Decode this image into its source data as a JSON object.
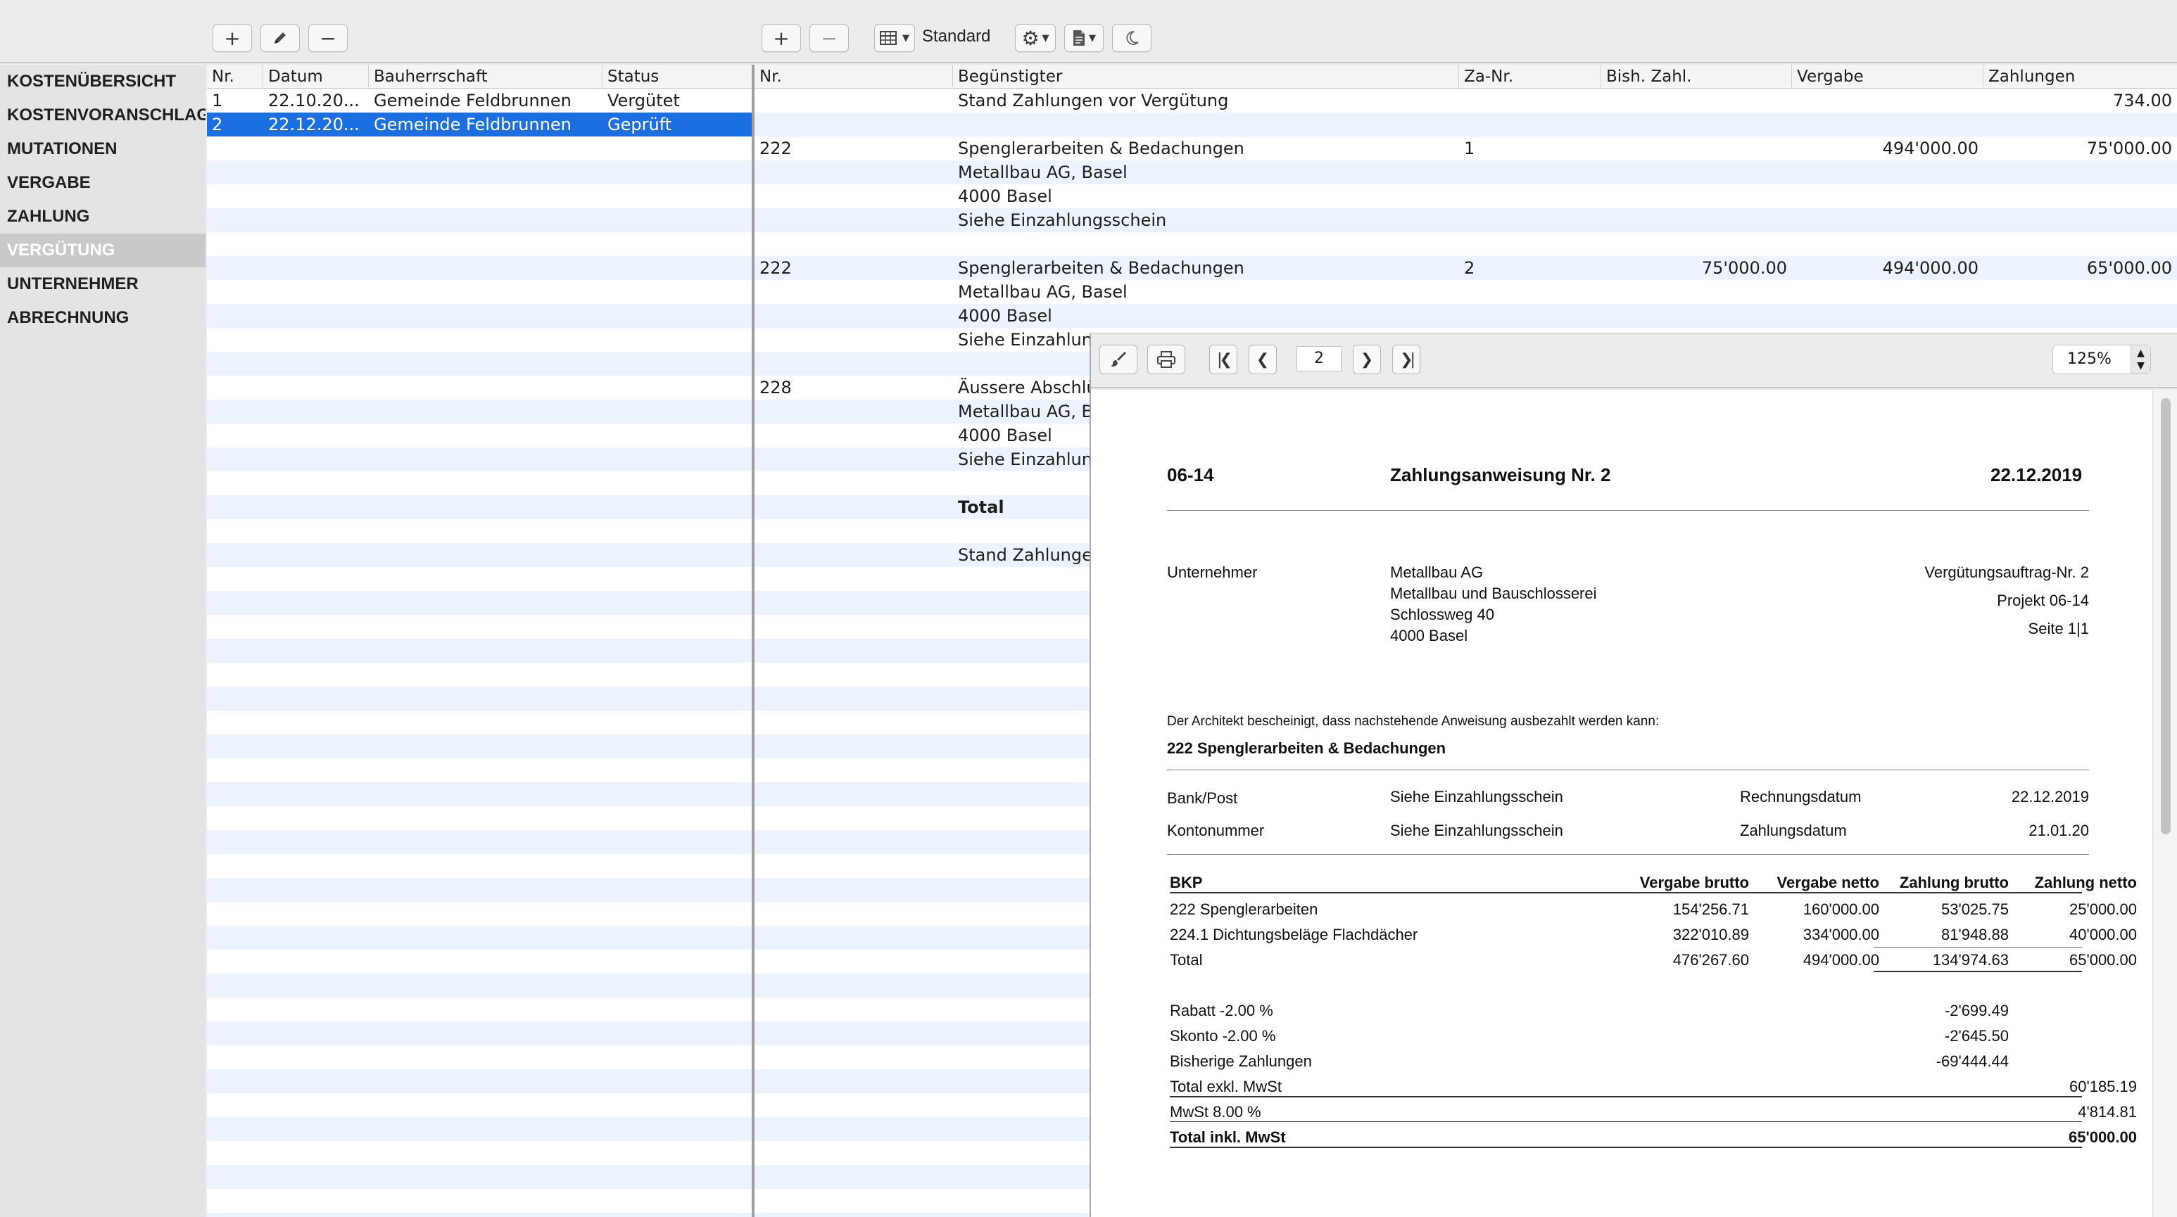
{
  "toolbar": {
    "left_buttons": [
      "+",
      "✎",
      "−"
    ],
    "right_buttons": [
      "+",
      "−"
    ],
    "view_label": "Standard"
  },
  "sidebar": {
    "items": [
      {
        "label": "KOSTENÜBERSICHT"
      },
      {
        "label": "KOSTENVORANSCHLAG"
      },
      {
        "label": "MUTATIONEN"
      },
      {
        "label": "VERGABE"
      },
      {
        "label": "ZAHLUNG"
      },
      {
        "label": "VERGÜTUNG"
      },
      {
        "label": "UNTERNEHMER"
      },
      {
        "label": "ABRECHNUNG"
      }
    ],
    "active_index": 5
  },
  "left_table": {
    "columns": [
      "Nr.",
      "Datum",
      "Bauherrschaft",
      "Status"
    ],
    "rows": [
      {
        "nr": "1",
        "datum": "22.10.20...",
        "bauherrschaft": "Gemeinde Feldbrunnen",
        "status": "Vergütet"
      },
      {
        "nr": "2",
        "datum": "22.12.20...",
        "bauherrschaft": "Gemeinde Feldbrunnen",
        "status": "Geprüft"
      }
    ],
    "selected_index": 1
  },
  "right_table": {
    "columns": [
      "Nr.",
      "Begünstigter",
      "Za-Nr.",
      "Bish. Zahl.",
      "Vergabe",
      "Zahlungen"
    ],
    "rows": [
      {
        "nr": "",
        "beg": "Stand Zahlungen vor Vergütung",
        "za": "",
        "bish": "",
        "vergabe": "",
        "zahlungen": "734.00"
      },
      {
        "nr": "",
        "beg": "",
        "za": "",
        "bish": "",
        "vergabe": "",
        "zahlungen": ""
      },
      {
        "nr": "222",
        "beg": "Spenglerarbeiten & Bedachungen",
        "za": "1",
        "bish": "",
        "vergabe": "494'000.00",
        "zahlungen": "75'000.00"
      },
      {
        "nr": "",
        "beg": "Metallbau AG, Basel",
        "za": "",
        "bish": "",
        "vergabe": "",
        "zahlungen": ""
      },
      {
        "nr": "",
        "beg": "4000  Basel",
        "za": "",
        "bish": "",
        "vergabe": "",
        "zahlungen": ""
      },
      {
        "nr": "",
        "beg": "Siehe Einzahlungsschein",
        "za": "",
        "bish": "",
        "vergabe": "",
        "zahlungen": ""
      },
      {
        "nr": "",
        "beg": "",
        "za": "",
        "bish": "",
        "vergabe": "",
        "zahlungen": ""
      },
      {
        "nr": "222",
        "beg": "Spenglerarbeiten & Bedachungen",
        "za": "2",
        "bish": "75'000.00",
        "vergabe": "494'000.00",
        "zahlungen": "65'000.00"
      },
      {
        "nr": "",
        "beg": "Metallbau AG, Basel",
        "za": "",
        "bish": "",
        "vergabe": "",
        "zahlungen": ""
      },
      {
        "nr": "",
        "beg": "4000  Basel",
        "za": "",
        "bish": "",
        "vergabe": "",
        "zahlungen": ""
      },
      {
        "nr": "",
        "beg": "Siehe Einzahlung",
        "za": "",
        "bish": "",
        "vergabe": "",
        "zahlungen": ""
      },
      {
        "nr": "",
        "beg": "",
        "za": "",
        "bish": "",
        "vergabe": "",
        "zahlungen": ""
      },
      {
        "nr": "228",
        "beg": "Äussere Abschlü",
        "za": "",
        "bish": "",
        "vergabe": "",
        "zahlungen": ""
      },
      {
        "nr": "",
        "beg": "Metallbau AG, Ba",
        "za": "",
        "bish": "",
        "vergabe": "",
        "zahlungen": ""
      },
      {
        "nr": "",
        "beg": "4000  Basel",
        "za": "",
        "bish": "",
        "vergabe": "",
        "zahlungen": ""
      },
      {
        "nr": "",
        "beg": "Siehe Einzahlung",
        "za": "",
        "bish": "",
        "vergabe": "",
        "zahlungen": ""
      },
      {
        "nr": "",
        "beg": "",
        "za": "",
        "bish": "",
        "vergabe": "",
        "zahlungen": ""
      },
      {
        "nr": "",
        "beg": "Total",
        "za": "",
        "bish": "",
        "vergabe": "",
        "zahlungen": "",
        "bold": true
      },
      {
        "nr": "",
        "beg": "",
        "za": "",
        "bish": "",
        "vergabe": "",
        "zahlungen": ""
      },
      {
        "nr": "",
        "beg": "Stand Zahlungen",
        "za": "",
        "bish": "",
        "vergabe": "",
        "zahlungen": ""
      }
    ]
  },
  "preview": {
    "page": "2",
    "zoom": "125%",
    "doc": {
      "code": "06-14",
      "title": "Zahlungsanweisung Nr. 2",
      "date": "22.12.2019",
      "unternehmer_label": "Unternehmer",
      "company": [
        "Metallbau AG",
        "Metallbau und Bauschlosserei",
        "Schlossweg 40",
        "4000 Basel"
      ],
      "right_info": [
        "Vergütungsauftrag-Nr. 2",
        "Projekt 06-14",
        "Seite 1|1"
      ],
      "certify": "Der Architekt bescheinigt, dass nachstehende Anweisung ausbezahlt werden kann:",
      "section": "222 Spenglerarbeiten & Bedachungen",
      "bank_label": "Bank/Post",
      "bank_value": "Siehe Einzahlungsschein",
      "rechnung_label": "Rechnungsdatum",
      "rechnung_value": "22.12.2019",
      "konto_label": "Kontonummer",
      "konto_value": "Siehe Einzahlungsschein",
      "zahlung_label": "Zahlungsdatum",
      "zahlung_value": "21.01.20",
      "table_head": [
        "BKP",
        "Vergabe brutto",
        "Vergabe netto",
        "Zahlung brutto",
        "Zahlung netto"
      ],
      "table_rows": [
        [
          "222 Spenglerarbeiten",
          "154'256.71",
          "160'000.00",
          "53'025.75",
          "25'000.00"
        ],
        [
          "224.1 Dichtungsbeläge Flachdächer",
          "322'010.89",
          "334'000.00",
          "81'948.88",
          "40'000.00"
        ],
        [
          "Total",
          "476'267.60",
          "494'000.00",
          "134'974.63",
          "65'000.00"
        ]
      ],
      "deductions": [
        {
          "label": "Rabatt -2.00 %",
          "col3": "-2'699.49",
          "col4": ""
        },
        {
          "label": "Skonto -2.00 %",
          "col3": "-2'645.50",
          "col4": ""
        },
        {
          "label": "Bisherige Zahlungen",
          "col3": "-69'444.44",
          "col4": ""
        },
        {
          "label": "Total exkl. MwSt",
          "col3": "",
          "col4": "60'185.19"
        },
        {
          "label": "MwSt 8.00 %",
          "col3": "",
          "col4": "4'814.81"
        },
        {
          "label": "Total inkl. MwSt",
          "col3": "",
          "col4": "65'000.00"
        }
      ]
    }
  }
}
